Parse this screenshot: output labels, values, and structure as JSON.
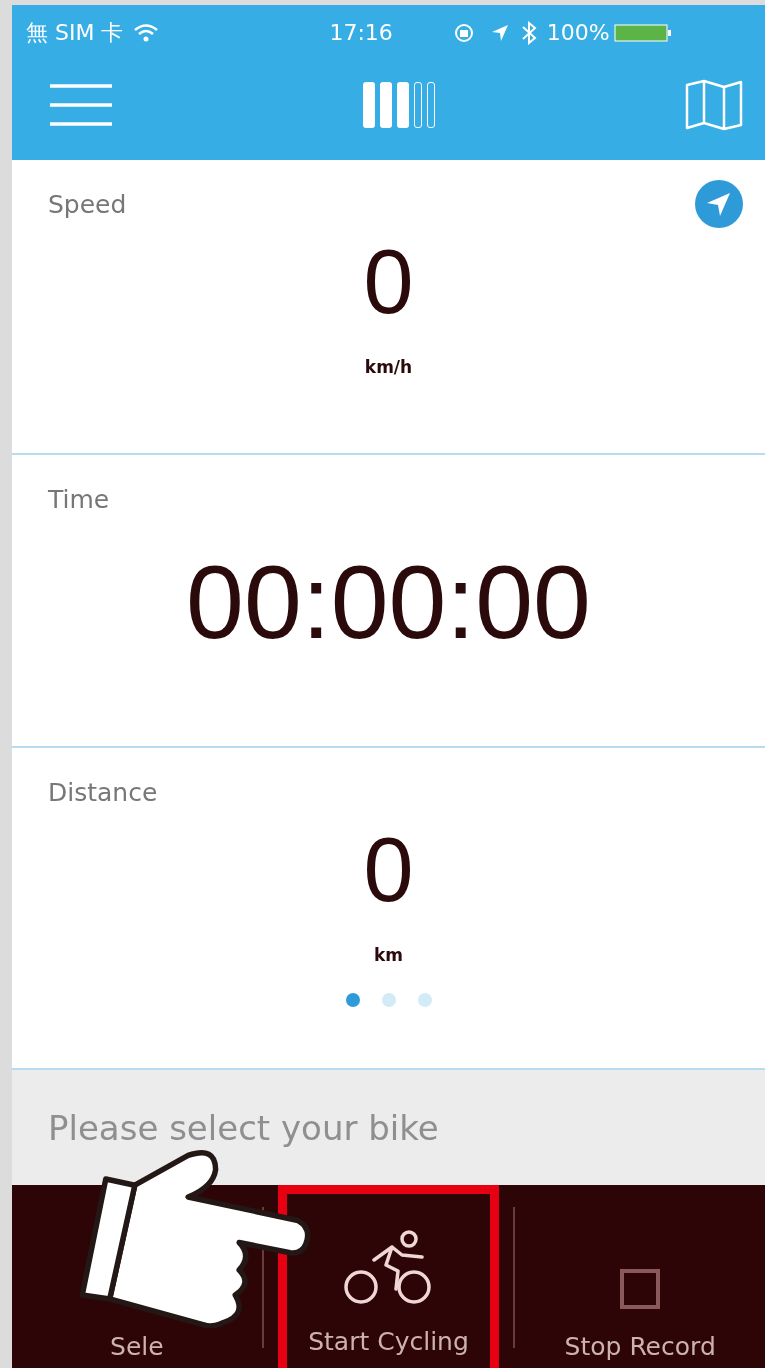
{
  "status_bar": {
    "carrier": "無 SIM 卡",
    "time": "17:16",
    "battery": "100%"
  },
  "nav": {
    "page_bars": [
      {
        "filled": true
      },
      {
        "filled": true
      },
      {
        "filled": true
      },
      {
        "filled": false
      },
      {
        "filled": false
      }
    ]
  },
  "metrics": [
    {
      "label": "Speed",
      "value": "0",
      "unit": "km/h",
      "locate": true
    },
    {
      "label": "Time",
      "value": "00:00:00",
      "locate": false
    },
    {
      "label": "Distance",
      "value": "0",
      "unit": "km",
      "locate": false
    }
  ],
  "page_dots": [
    {
      "selected": true
    },
    {
      "selected": false
    },
    {
      "selected": false
    }
  ],
  "bike_prompt": "Please select your bike",
  "toolbar": [
    {
      "kind": "select",
      "label": "Sele",
      "highlighted": false
    },
    {
      "kind": "cycle",
      "label": "Start Cycling",
      "highlighted": true
    },
    {
      "kind": "stop",
      "label": "Stop Record",
      "highlighted": false
    }
  ]
}
